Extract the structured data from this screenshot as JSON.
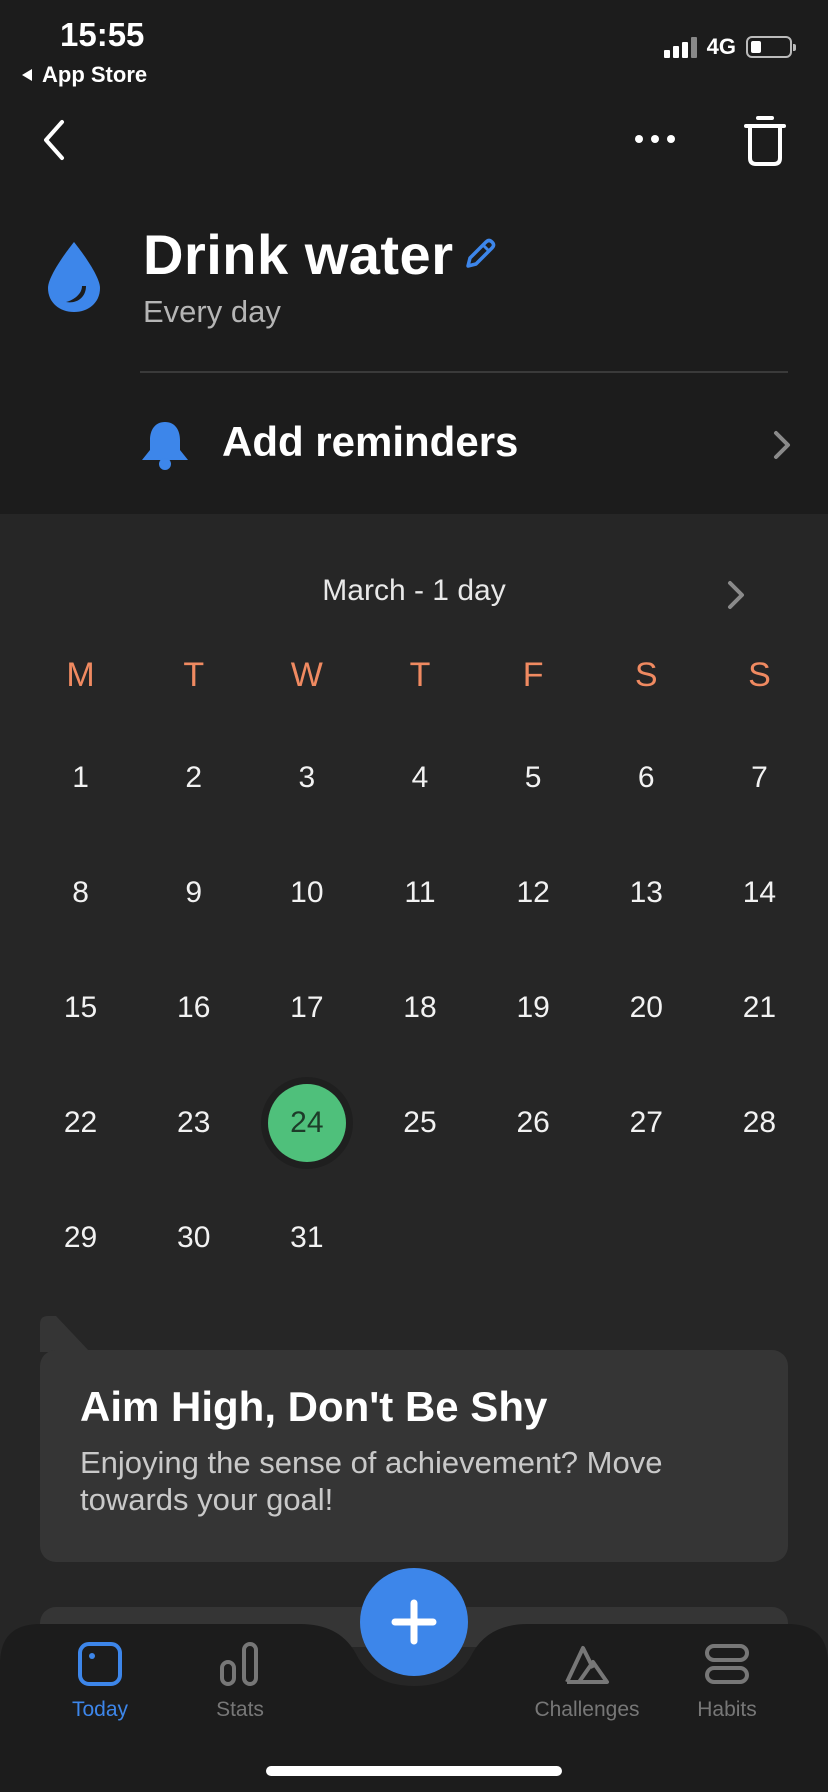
{
  "status_bar": {
    "time": "15:55",
    "back_app": "App Store",
    "network": "4G"
  },
  "habit": {
    "title": "Drink water",
    "frequency": "Every day",
    "reminders_label": "Add reminders"
  },
  "calendar": {
    "month_label": "March - 1 day",
    "weekdays": [
      "M",
      "T",
      "W",
      "T",
      "F",
      "S",
      "S"
    ],
    "days": [
      "1",
      "2",
      "3",
      "4",
      "5",
      "6",
      "7",
      "8",
      "9",
      "10",
      "11",
      "12",
      "13",
      "14",
      "15",
      "16",
      "17",
      "18",
      "19",
      "20",
      "21",
      "22",
      "23",
      "24",
      "25",
      "26",
      "27",
      "28",
      "29",
      "30",
      "31"
    ],
    "selected_day": "24"
  },
  "card": {
    "title": "Aim High, Don't Be Shy",
    "text": "Enjoying the sense of achievement? Move towards your goal!"
  },
  "tabs": [
    {
      "label": "Today",
      "icon": "today-icon"
    },
    {
      "label": "Stats",
      "icon": "stats-icon"
    },
    {
      "label": "Challenges",
      "icon": "challenges-icon"
    },
    {
      "label": "Habits",
      "icon": "habits-icon"
    }
  ],
  "colors": {
    "accent": "#3d86ea",
    "weekday": "#f08a61",
    "selected": "#4fc07b"
  }
}
